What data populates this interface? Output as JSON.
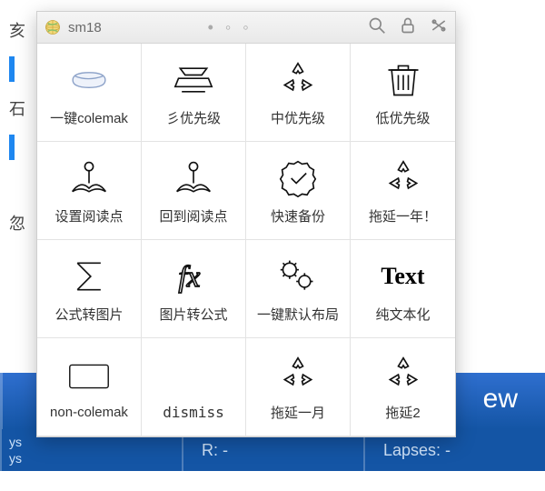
{
  "header": {
    "title": "sm18",
    "search_icon": "search",
    "lock_icon": "lock",
    "settings_icon": "settings"
  },
  "grid": [
    {
      "id": "pillow",
      "label": "一键colemak"
    },
    {
      "id": "priority-top",
      "label": "彡优先级"
    },
    {
      "id": "priority-mid",
      "label": "中优先级"
    },
    {
      "id": "priority-low",
      "label": "低优先级"
    },
    {
      "id": "set-readpoint",
      "label": "设置阅读点"
    },
    {
      "id": "goto-readpoint",
      "label": "回到阅读点"
    },
    {
      "id": "quick-backup",
      "label": "快速备份"
    },
    {
      "id": "postpone-year",
      "label": "拖延一年！"
    },
    {
      "id": "formula2img",
      "label": "公式转图片"
    },
    {
      "id": "img2formula",
      "label": "图片转公式"
    },
    {
      "id": "default-layout",
      "label": "一键默认布局"
    },
    {
      "id": "plain-text",
      "label": "纯文本化",
      "word": "Text"
    },
    {
      "id": "non-colemak",
      "label": "non-colemak"
    },
    {
      "id": "dismiss",
      "label": "dismiss"
    },
    {
      "id": "postpone-month",
      "label": "拖延一月"
    },
    {
      "id": "postpone-2",
      "label": "拖延2"
    }
  ],
  "background": {
    "left_letters": [
      "亥",
      "石",
      "忽"
    ],
    "banner_fragment": "ew",
    "status": {
      "row1": "ys",
      "row2": "ys",
      "mid": "R: -",
      "right": "Lapses: -"
    }
  }
}
